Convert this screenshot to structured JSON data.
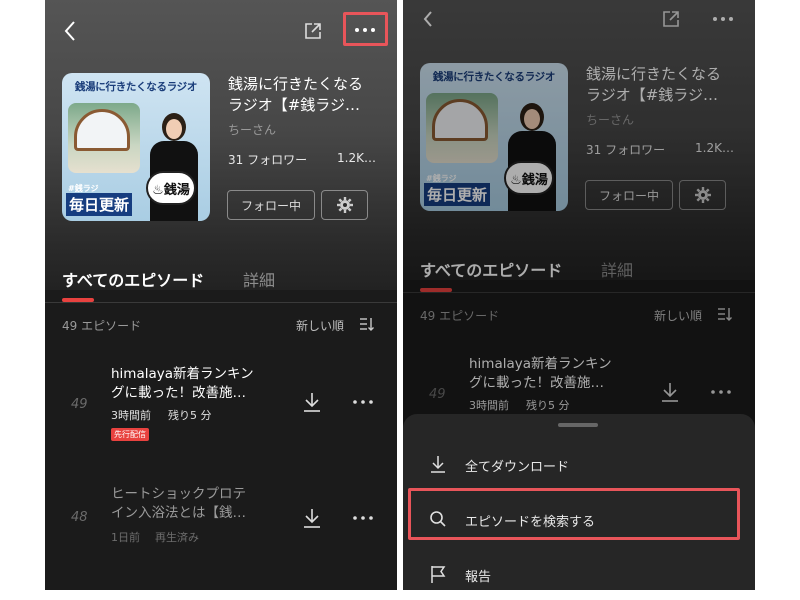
{
  "podcast": {
    "cover_title": "銭湯に行きたくなるラジオ",
    "cover_tag": "#銭ラジ",
    "cover_daily": "毎日更新",
    "cover_sign": "♨銭湯",
    "title_line1": "銭湯に行きたくなる",
    "title_line2": "ラジオ【#銭ラジ…",
    "author": "ちーさん",
    "followers": "31 フォロワー",
    "plays": "1.2K…",
    "follow_button": "フォロー中"
  },
  "tabs": [
    {
      "label": "すべてのエピソード",
      "active": true
    },
    {
      "label": "詳細",
      "active": false
    }
  ],
  "episode_count": "49 エピソード",
  "sort_label": "新しい順",
  "episodes": [
    {
      "number": "49",
      "title_line1": "himalaya新着ランキン",
      "title_line2": "グに載った！改善施…",
      "time": "3時間前",
      "remaining": "残り5 分",
      "badge": "先行配信"
    },
    {
      "number": "48",
      "title_line1": "ヒートショックプロテ",
      "title_line2": "イン入浴法とは【銭…",
      "time": "1日前",
      "status": "再生済み"
    }
  ],
  "sheet_items": [
    {
      "label": "全てダウンロード",
      "icon": "download-icon"
    },
    {
      "label": "エピソードを検索する",
      "icon": "search-icon"
    },
    {
      "label": "報告",
      "icon": "flag-icon"
    }
  ],
  "colors": {
    "accent": "#e8423f",
    "highlight": "#e8555a",
    "background": "#1b1b1b",
    "sheet": "#262626"
  }
}
